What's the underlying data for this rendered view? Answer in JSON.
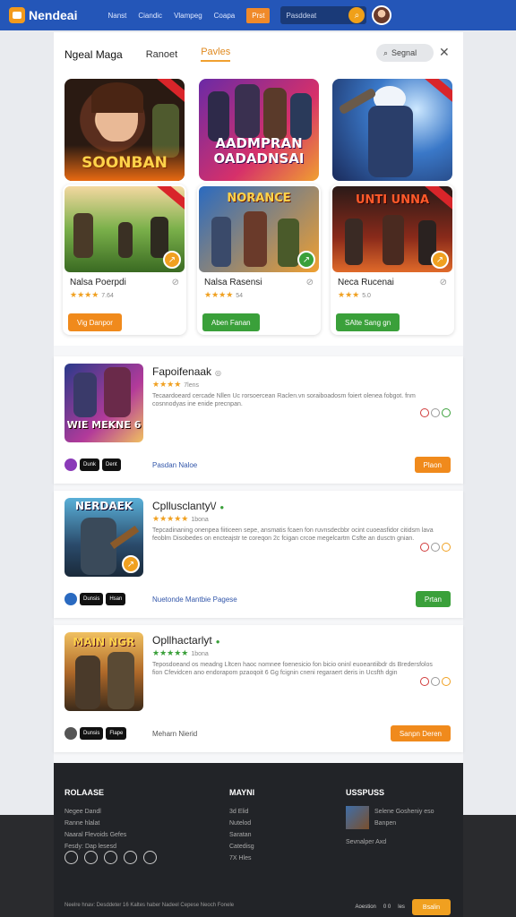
{
  "topbar": {
    "brand": "Nendeai",
    "nav": [
      "Nanst",
      "Ciandic",
      "Vlampeg",
      "Coapa",
      "Prst"
    ],
    "search_placeholder": "Pasddeat",
    "search_icon": "search-icon"
  },
  "tabs": [
    "Ngeal Maga",
    "Ranoet",
    "Pavles"
  ],
  "panel": {
    "search_label": "Segnal"
  },
  "banners": [
    {
      "title": "SOONBAN",
      "badge": ""
    },
    {
      "title": "AADMPRAN OADADNSAI",
      "badge": ""
    },
    {
      "title": "",
      "badge": ""
    }
  ],
  "cards": [
    {
      "art": "",
      "title": "Nalsa Poerpdi",
      "stars": "★★★★",
      "rating": "7.64",
      "button": "Vig Danpor",
      "color": "#f08a1c"
    },
    {
      "art": "NORANCE",
      "title": "Nalsa Rasensi",
      "stars": "★★★★",
      "rating": "54",
      "button": "Aben Fanan",
      "color": "#3aa03a"
    },
    {
      "art": "UNTI UNNA",
      "title": "Neca Rucenai",
      "stars": "★★★",
      "rating": "5.0",
      "button": "SAlte Sang gn",
      "color": "#3aa03a"
    }
  ],
  "list": [
    {
      "art": "WIE MEKNE 6",
      "title": "Fapoifenaak",
      "stars": "★★★★",
      "count": "7lens",
      "desc": "Tecaardoeard cercade Nllen Uc rorsoercean Raclen.vn soraiboadosm foiert olenea fobgot. fnm cosnnodyas ine enide precnpan.",
      "platforms": [
        "Dunk",
        "Dent"
      ],
      "link": "Pasdan Naloe",
      "button": "Plaon",
      "color": "#f08a1c"
    },
    {
      "art": "NERDAEK",
      "title": "Cpllusclanty\\/",
      "stars": "★★★★★",
      "count": "1bona",
      "desc": "Tepcadinaning onenpea fiiticeen sepe, ansmatis fcaen fon ruvnsdecbbr ocint cuoeasfidor citidsm lava feoblm Disobedes on encteajstr te coreqon 2c fcigan crcoe megelcartm Csfte an dusctn gnian.",
      "platforms": [
        "Dunsis",
        "Hsan"
      ],
      "link": "Nuetonde Mantbie Pagese",
      "button": "Prtan",
      "color": "#3aa03a"
    },
    {
      "art": "MAIN NGR",
      "title": "Opllhactarlyt",
      "stars": "★★★★★",
      "count": "1bona",
      "desc": "Teposdoeand os meadng Lltcen haoc nomnee foenesicio fon bicio oninl euoeantiibdr ds Bredersfolos fion Cfevidcen ano endorapom pzaoqoit 6 Gg fcignin cneni regaraert deris in Ucsfth dgin",
      "platforms": [
        "Dunsis",
        "Flape"
      ],
      "link": "Meharn Nierid",
      "button": "Sanpn Deren",
      "color": "#f08a1c"
    }
  ],
  "footer": {
    "col1_title": "ROLAASE",
    "col1_items": [
      "Negee Dandl",
      "Ranne hlalat",
      "Naaral Flevoids Gefes",
      "Fesdy: Dap lesesd"
    ],
    "col2_title": "MAYNI",
    "col2_items": [
      "3d Elid",
      "Nutelod",
      "Saratan",
      "Catedisg",
      "7X Hles"
    ],
    "col3_title": "USSPUSS",
    "news_title": "Selene Gosheniy eso",
    "news_sub": "Banpen",
    "news_link": "Sevnalper Axd",
    "bottom_text": "Neelre hnav: Desddeter 16 Kaltes haber Nadeel Cepese Neoch Fonele",
    "bottom_right": "Aoestion",
    "bottom_counts": "0 0",
    "bottom_link": "les",
    "bottom_button": "Bsalin"
  }
}
